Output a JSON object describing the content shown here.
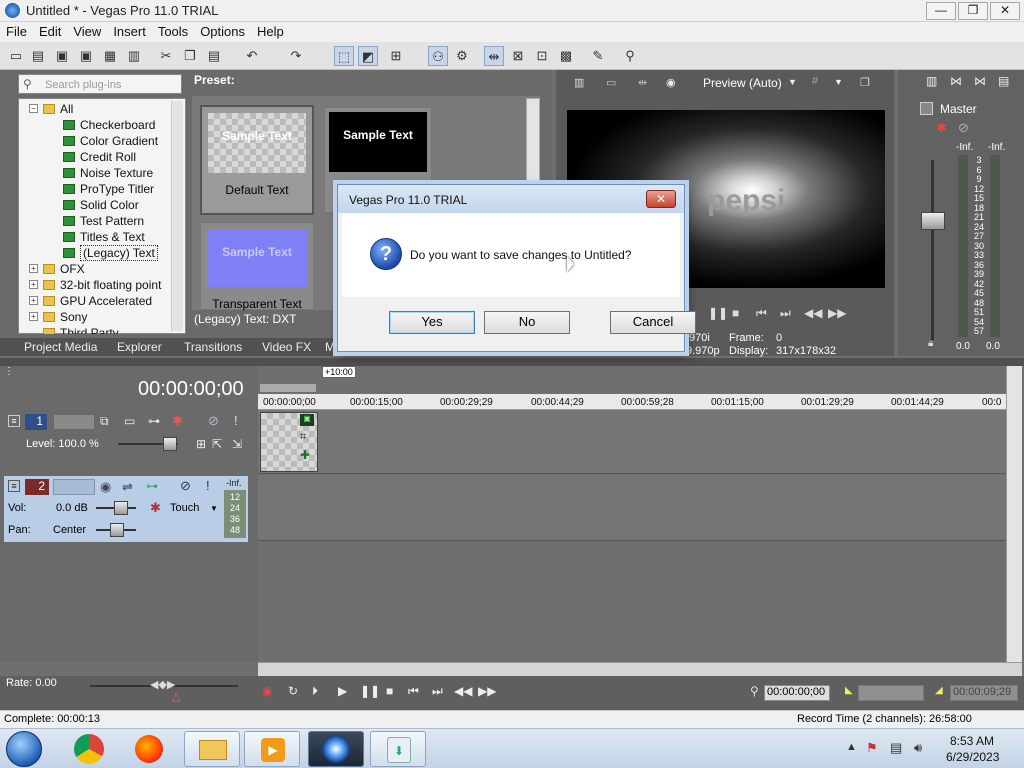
{
  "window": {
    "title": "Untitled * - Vegas Pro 11.0 TRIAL",
    "minimize": "—",
    "maximize": "❐",
    "close": "✕"
  },
  "menu": [
    "File",
    "Edit",
    "View",
    "Insert",
    "Tools",
    "Options",
    "Help"
  ],
  "plugins": {
    "search_placeholder": "Search plug-ins",
    "preset_label": "Preset:",
    "tree": [
      {
        "label": "All",
        "type": "folder"
      },
      {
        "label": "Checkerboard",
        "type": "fx"
      },
      {
        "label": "Color Gradient",
        "type": "fx"
      },
      {
        "label": "Credit Roll",
        "type": "fx"
      },
      {
        "label": "Noise Texture",
        "type": "fx"
      },
      {
        "label": "ProType Titler",
        "type": "fx"
      },
      {
        "label": "Solid Color",
        "type": "fx"
      },
      {
        "label": "Test Pattern",
        "type": "fx"
      },
      {
        "label": "Titles & Text",
        "type": "fx"
      },
      {
        "label": "(Legacy) Text",
        "type": "fx"
      },
      {
        "label": "OFX",
        "type": "folder"
      },
      {
        "label": "32-bit floating point",
        "type": "folder"
      },
      {
        "label": "GPU Accelerated",
        "type": "folder"
      },
      {
        "label": "Sony",
        "type": "folder"
      },
      {
        "label": "Third Party",
        "type": "folder"
      }
    ],
    "presets": [
      {
        "sample": "Sample Text",
        "name": "Default Text"
      },
      {
        "sample": "Sample Text",
        "name": ""
      },
      {
        "sample": "Sample Text",
        "name": "Transparent Text"
      }
    ],
    "status": "(Legacy) Text: DXT"
  },
  "tabs": [
    "Project Media",
    "Explorer",
    "Transitions",
    "Video FX",
    "M"
  ],
  "preview": {
    "mode": "Preview (Auto)",
    "overlay_text": "pepsi",
    "frame_label": "Frame:",
    "frame_value": "0",
    "display_label": "Display:",
    "display_value": "317x178x32",
    "partial1": ".970i",
    "partial2": "9.970p"
  },
  "master": {
    "label": "Master",
    "db_left": "-Inf.",
    "db_right": "-Inf.",
    "scale": [
      "3",
      "6",
      "9",
      "12",
      "15",
      "18",
      "21",
      "24",
      "27",
      "30",
      "33",
      "36",
      "39",
      "42",
      "45",
      "48",
      "51",
      "54",
      "57"
    ],
    "bottom_left": "0.0",
    "bottom_right": "0.0"
  },
  "dialog": {
    "title": "Vegas Pro 11.0 TRIAL",
    "message": "Do you want to save changes to Untitled?",
    "yes": "Yes",
    "no": "No",
    "cancel": "Cancel",
    "icon": "question-icon"
  },
  "timeline": {
    "timecode": "00:00:00;00",
    "offset_label": "+10:00",
    "ruler": [
      "00:00:00;00",
      "00:00:15;00",
      "00:00:29;29",
      "00:00:44;29",
      "00:00:59;28",
      "00:01:15;00",
      "00:01:29;29",
      "00:01:44;29",
      "00:0"
    ],
    "video_track": {
      "number": "1",
      "level": "Level: 100.0 %"
    },
    "audio_track": {
      "number": "2",
      "vol_label": "Vol:",
      "vol_value": "0.0 dB",
      "pan_label": "Pan:",
      "pan_value": "Center",
      "mode": "Touch",
      "meter": "-Inf.",
      "meter_scale": [
        "12",
        "24",
        "36",
        "48"
      ]
    },
    "rate": "Rate: 0.00",
    "transport_time": "00:00:00;00",
    "end_time": "00:00:09;29"
  },
  "status": {
    "complete": "Complete: 00:00:13",
    "record_time": "Record Time (2 channels): 26:58:00"
  },
  "taskbar": {
    "time": "8:53 AM",
    "date": "6/29/2023"
  }
}
